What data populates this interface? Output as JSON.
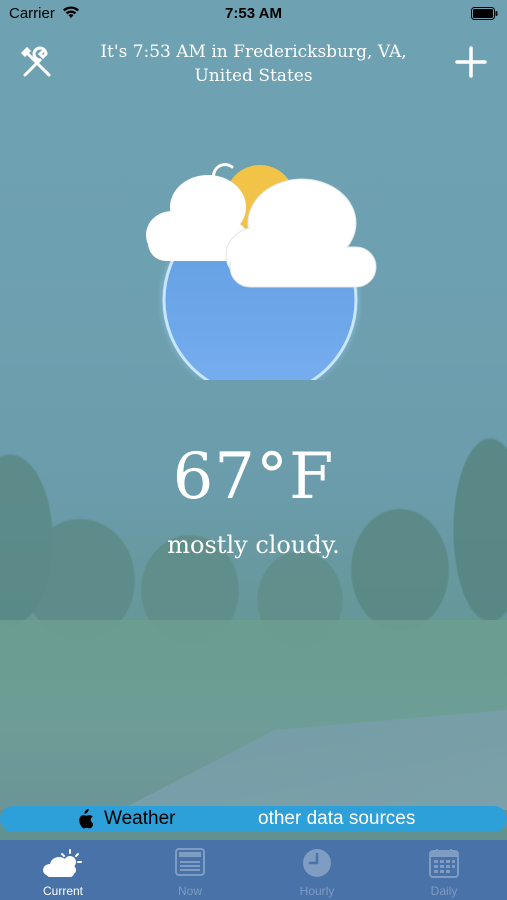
{
  "status_bar": {
    "carrier": "Carrier",
    "time": "7:53 AM"
  },
  "header": {
    "location_line1": "It's 7:53 AM in Fredericksburg, VA,",
    "location_line2": "United States",
    "tools_icon": "wrench-screwdriver-icon",
    "add_icon": "plus-icon"
  },
  "current": {
    "icon": "partly-cloudy-icon",
    "temperature": "67°F",
    "condition": "mostly cloudy."
  },
  "data_source": {
    "provider_logo": "apple-logo-icon",
    "provider_label": "Weather",
    "other_label": "other data sources"
  },
  "tabs": [
    {
      "label": "Current",
      "icon": "sun-cloud-icon",
      "active": true
    },
    {
      "label": "Now",
      "icon": "document-icon",
      "active": false
    },
    {
      "label": "Hourly",
      "icon": "clock-icon",
      "active": false
    },
    {
      "label": "Daily",
      "icon": "calendar-icon",
      "active": false
    }
  ],
  "colors": {
    "tab_bar": "#4872a8",
    "source_bar": "#2d9fd9",
    "tab_inactive": "#7f9cc2"
  }
}
